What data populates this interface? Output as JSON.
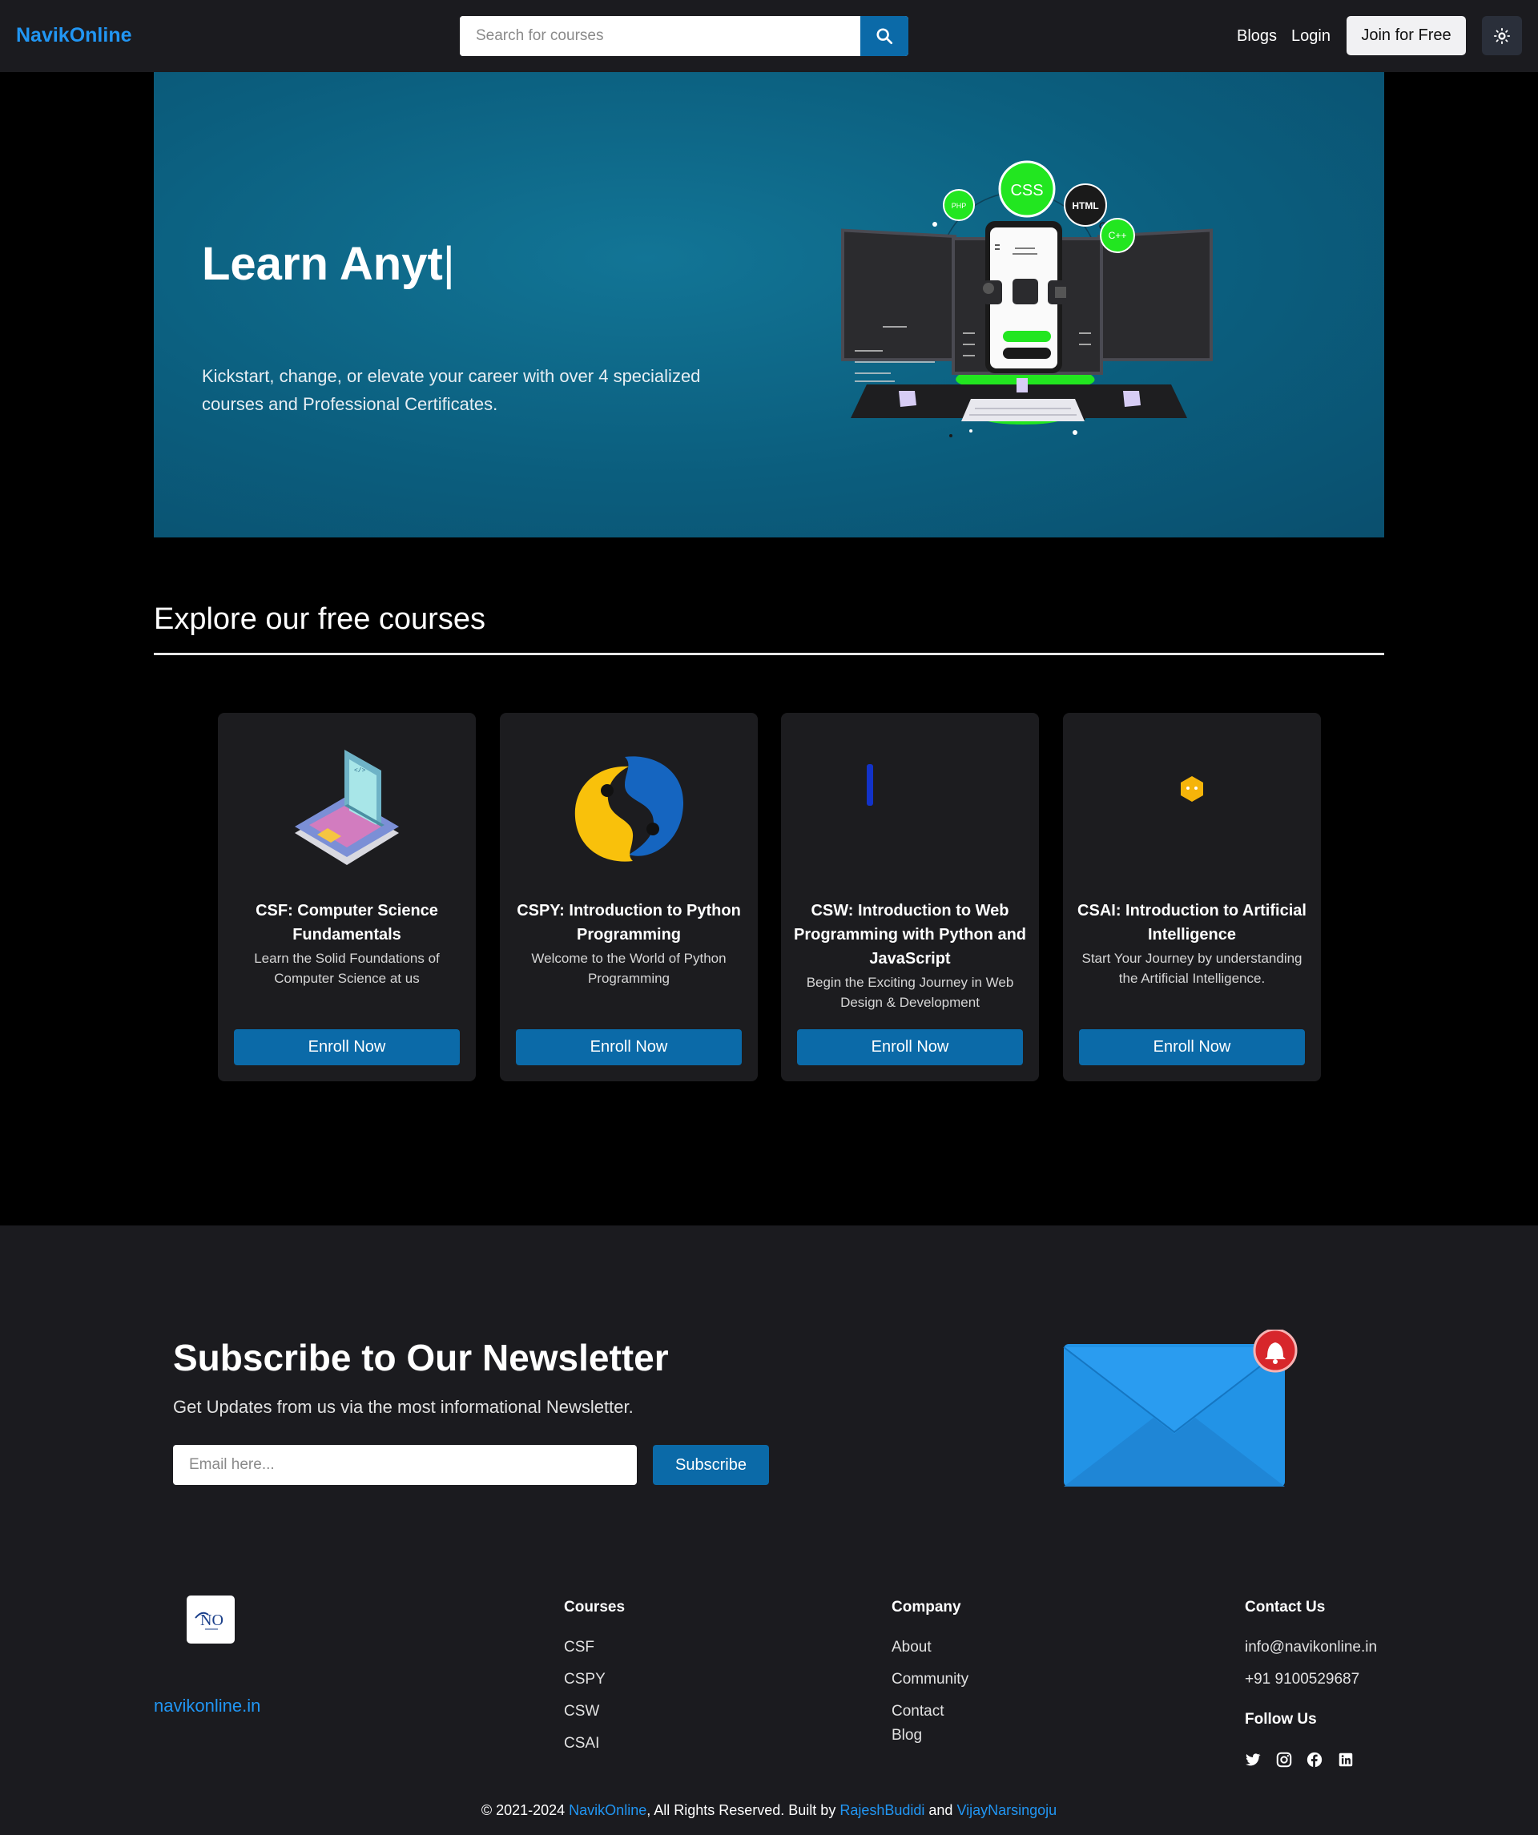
{
  "nav": {
    "brand": "NavikOnline",
    "search_placeholder": "Search for courses",
    "links": [
      "Blogs",
      "Login"
    ],
    "join_label": "Join for Free"
  },
  "hero": {
    "title": "Learn Anyt",
    "cursor": "|",
    "subtitle": "Kickstart, change, or elevate your career with over 4 specialized courses and Professional Certificates.",
    "art_badges": [
      "CSS",
      "HTML",
      "PHP",
      "C++"
    ]
  },
  "explore": {
    "title": "Explore our free courses"
  },
  "courses": [
    {
      "title": "CSF: Computer Science Fundamentals",
      "desc": "Learn the Solid Foundations of Computer Science at us",
      "button": "Enroll Now",
      "icon": "laptop-icon"
    },
    {
      "title": "CSPY: Introduction to Python Programming",
      "desc": "Welcome to the World of Python Programming",
      "button": "Enroll Now",
      "icon": "python-icon"
    },
    {
      "title": "CSW: Introduction to Web Programming with Python and JavaScript",
      "desc": "Begin the Exciting Journey in Web Design & Development",
      "button": "Enroll Now",
      "icon": "web-icon"
    },
    {
      "title": "CSAI: Introduction to Artificial Intelligence",
      "desc": "Start Your Journey by understanding the Artificial Intelligence.",
      "button": "Enroll Now",
      "icon": "ai-icon"
    }
  ],
  "newsletter": {
    "title": "Subscribe to Our Newsletter",
    "subtitle": "Get Updates from us via the most informational Newsletter.",
    "placeholder": "Email here...",
    "button": "Subscribe"
  },
  "footer": {
    "logo_text": "NO",
    "site": "navikonline.in",
    "courses_head": "Courses",
    "courses": [
      "CSF",
      "CSPY",
      "CSW",
      "CSAI"
    ],
    "company_head": "Company",
    "company": [
      "About",
      "Community",
      "Contact",
      "Blog"
    ],
    "contact_head": "Contact Us",
    "email": "info@navikonline.in",
    "phone": "+91 9100529687",
    "follow_head": "Follow Us",
    "social": [
      "twitter-icon",
      "instagram-icon",
      "facebook-icon",
      "linkedin-icon"
    ],
    "copyright": {
      "prefix": "© 2021-2024 ",
      "brand": "NavikOnline",
      "middle": ", All Rights Reserved. Built by ",
      "author1": "RajeshBudidi",
      "and": " and ",
      "author2": "VijayNarsingoju"
    }
  },
  "colors": {
    "accent": "#2196f3",
    "button": "#0b6aa8",
    "bg": "#000000",
    "panel": "#1b1b1f",
    "card": "#1c1c1f",
    "neon": "#22e620"
  }
}
